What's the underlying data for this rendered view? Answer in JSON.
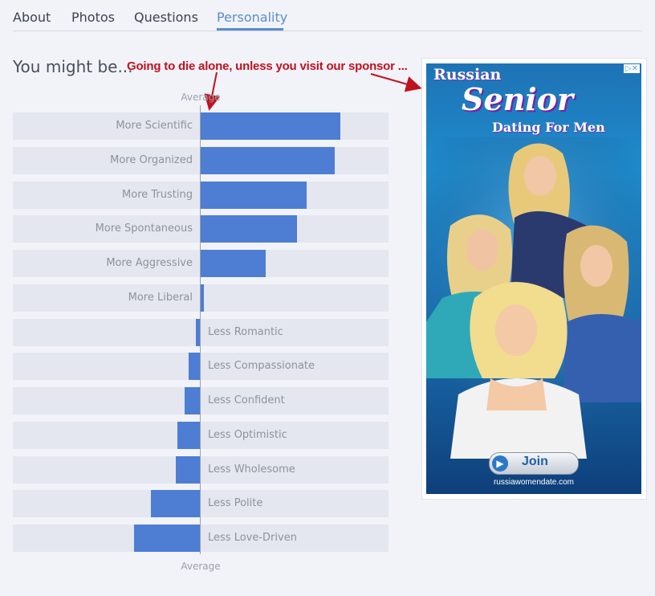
{
  "tabs": [
    {
      "label": "About"
    },
    {
      "label": "Photos"
    },
    {
      "label": "Questions"
    },
    {
      "label": "Personality",
      "active": true
    }
  ],
  "heading": "You might be...",
  "annotation": "Going to die alone, unless you visit our sponsor ...",
  "axis": {
    "top_label": "Average",
    "bottom_label": "Average"
  },
  "traits": [
    {
      "label": "More Scientific",
      "value": 0.75
    },
    {
      "label": "More Organized",
      "value": 0.72
    },
    {
      "label": "More Trusting",
      "value": 0.57
    },
    {
      "label": "More Spontaneous",
      "value": 0.52
    },
    {
      "label": "More Aggressive",
      "value": 0.35
    },
    {
      "label": "More Liberal",
      "value": 0.02
    },
    {
      "label": "Less Romantic",
      "value": -0.02
    },
    {
      "label": "Less Compassionate",
      "value": -0.06
    },
    {
      "label": "Less Confident",
      "value": -0.08
    },
    {
      "label": "Less Optimistic",
      "value": -0.12
    },
    {
      "label": "Less Wholesome",
      "value": -0.13
    },
    {
      "label": "Less Polite",
      "value": -0.26
    },
    {
      "label": "Less Love-Driven",
      "value": -0.35
    }
  ],
  "ad": {
    "title_line1": "Russian",
    "title_line2": "Senior",
    "title_line3": "Dating For Men",
    "join_label": "Join",
    "url": "russiawomendate.com",
    "choices_icon": "adchoices-icon"
  },
  "colors": {
    "accent": "#5b8bd0",
    "bar": "#4e7dd4",
    "annotation": "#c1121f"
  }
}
